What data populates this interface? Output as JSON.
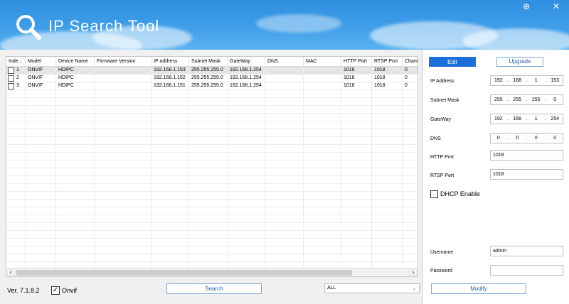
{
  "app": {
    "title": "IP Search Tool",
    "version": "Ver. 7.1.8.2"
  },
  "window_controls": {
    "extra_glyph": "⊕",
    "close_glyph": "✕"
  },
  "table": {
    "columns": [
      "Inde...",
      "Model",
      "Device Name",
      "Firmware Version",
      "IP address",
      "Subnet Mask",
      "GateWay",
      "DNS",
      "MAC",
      "HTTP Port",
      "RTSP Port",
      "Chann"
    ],
    "rows": [
      [
        "1",
        "ONVIF",
        "HDIPC",
        "",
        "192.168.1.153",
        "255.255.255.0",
        "192.168.1.254",
        "",
        "",
        "1018",
        "1018",
        "0"
      ],
      [
        "2",
        "ONVIF",
        "HDIPC",
        "",
        "192.168.1.152",
        "255.255.255.0",
        "192.168.1.254",
        "",
        "",
        "1018",
        "1018",
        "0"
      ],
      [
        "3",
        "ONVIF",
        "HDIPC",
        "",
        "192.168.1.151",
        "255.255.255.0",
        "192.168.1.254",
        "",
        "",
        "1018",
        "1018",
        "0"
      ]
    ],
    "selected_row": 0,
    "scroll_left_glyph": "‹",
    "scroll_right_glyph": "›"
  },
  "bottom": {
    "onvif_label": "Onvif",
    "onvif_checked": true,
    "check_glyph": "✓",
    "search_label": "Search",
    "filter_value": "ALL",
    "chevron_glyph": "⌄"
  },
  "panel": {
    "edit_label": "Edit",
    "upgrade_label": "Upgrade",
    "ip_label": "IP Address",
    "ip_value": [
      "192",
      "168",
      "1",
      "153"
    ],
    "subnet_label": "Subnet Mask",
    "subnet_value": [
      "255",
      "255",
      "255",
      "0"
    ],
    "gateway_label": "GateWay",
    "gateway_value": [
      "192",
      "168",
      "1",
      "254"
    ],
    "dns_label": "DNS",
    "dns_value": [
      "0",
      "0",
      "0",
      "0"
    ],
    "http_label": "HTTP Port",
    "http_value": "1018",
    "rtsp_label": "RTSP Port",
    "rtsp_value": "1018",
    "dhcp_label": "DHCP Enable",
    "dhcp_checked": false,
    "username_label": "Username",
    "username_value": "admin",
    "password_label": "Password",
    "password_value": "",
    "modify_label": "Modify",
    "ip_separator": "."
  },
  "colors": {
    "header": "#3f9ee8",
    "accent": "#1a6fd8"
  }
}
